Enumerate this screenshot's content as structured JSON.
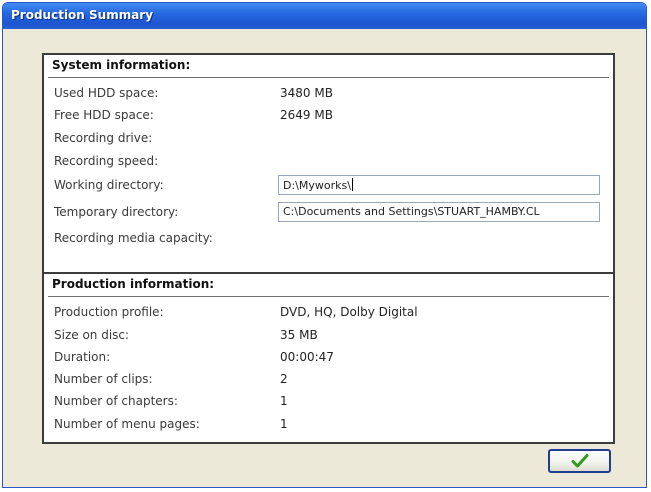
{
  "window": {
    "title": "Production Summary"
  },
  "system": {
    "header": "System information:",
    "rows": [
      {
        "label": "Used HDD space:",
        "value": "3480 MB"
      },
      {
        "label": "Free HDD space:",
        "value": "2649 MB"
      },
      {
        "label": "Recording drive:",
        "value": ""
      },
      {
        "label": "Recording speed:",
        "value": ""
      },
      {
        "label": "Working directory:",
        "value": "D:\\Myworks\\"
      },
      {
        "label": "Temporary directory:",
        "value": "C:\\Documents and Settings\\STUART_HAMBY.CL"
      },
      {
        "label": "Recording media capacity:",
        "value": ""
      }
    ]
  },
  "production": {
    "header": "Production information:",
    "rows": [
      {
        "label": "Production profile:",
        "value": "DVD, HQ, Dolby Digital"
      },
      {
        "label": "Size on disc:",
        "value": "35 MB"
      },
      {
        "label": "Duration:",
        "value": "00:00:47"
      },
      {
        "label": "Number of clips:",
        "value": "2"
      },
      {
        "label": "Number of chapters:",
        "value": "1"
      },
      {
        "label": "Number of menu pages:",
        "value": "1"
      }
    ]
  },
  "ok_button": {
    "icon": "checkmark-icon",
    "color": "#2f9a1e"
  }
}
